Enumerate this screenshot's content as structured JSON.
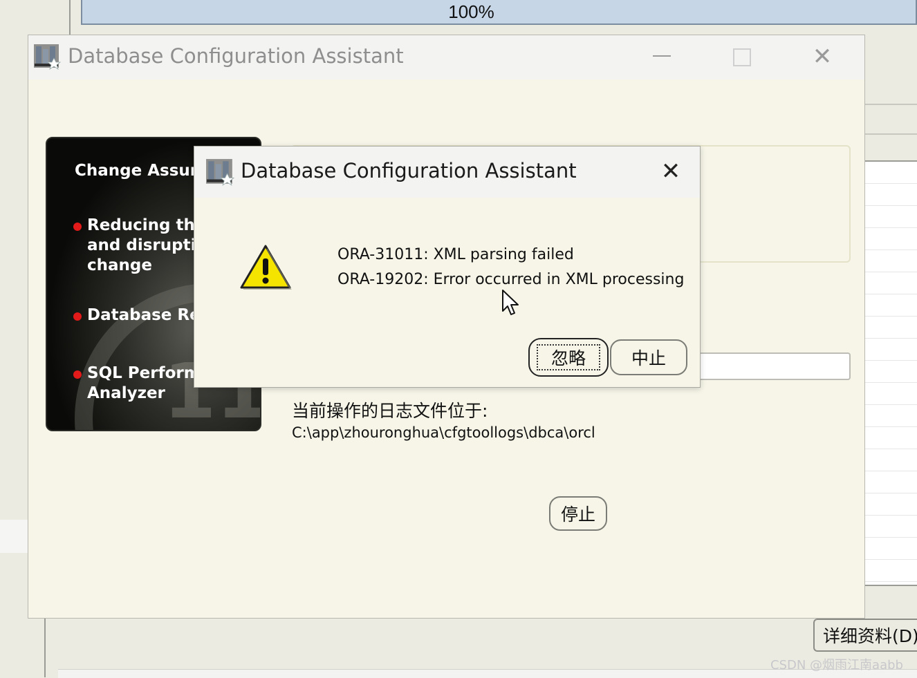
{
  "background": {
    "progress_text": "100%",
    "details_button": "详细资料(D)",
    "watermark": "CSDN @烟雨江南aabb"
  },
  "main_window": {
    "title": "Database Configuration Assistant",
    "icon": "dbca-app-icon",
    "controls": [
      "minimize-icon",
      "maximize-icon",
      "close-icon"
    ],
    "side_panel": {
      "heading": "Change Assura",
      "bullets": [
        "Reducing the\nand disruptio\nchange",
        "Database Rep",
        "SQL Perform\nAnalyzer"
      ]
    },
    "log_label": "当前操作的日志文件位于:",
    "log_path": "C:\\app\\zhouronghua\\cfgtoollogs\\dbca\\orcl",
    "stop_button": "停止"
  },
  "dialog": {
    "title": "Database Configuration Assistant",
    "icon": "dbca-app-icon",
    "close_icon": "close-icon",
    "warning_icon": "warning-icon",
    "messages": [
      "ORA-31011: XML parsing failed",
      "ORA-19202: Error occurred in XML processing"
    ],
    "buttons": {
      "ignore": "忽略",
      "abort": "中止"
    }
  },
  "colors": {
    "window_bg": "#f6f5e8",
    "titlebar_bg": "#f3f3f1",
    "progress_bar": "#c6d6e6",
    "bullet_red": "#e21a1a",
    "warning_yellow": "#f5e400"
  }
}
